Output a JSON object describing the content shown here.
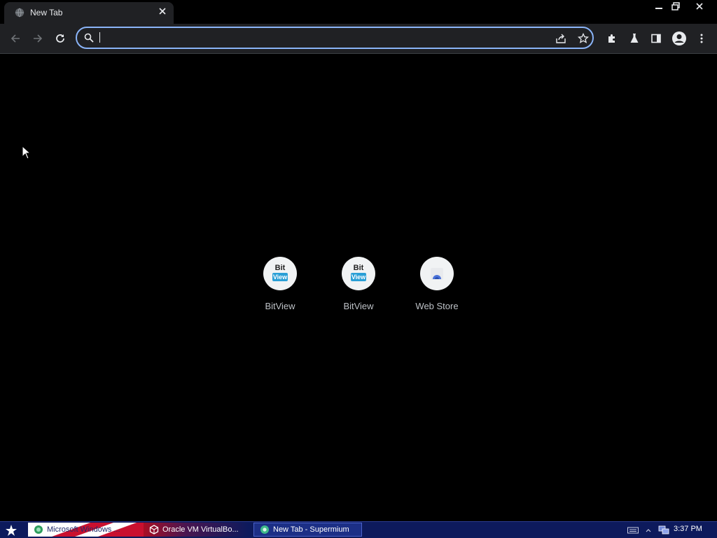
{
  "tab": {
    "title": "New Tab",
    "favicon": "globe-icon",
    "close_icon": "close-icon"
  },
  "window_controls": {
    "minimize": "minimize-icon",
    "restore": "restore-icon",
    "close": "close-icon"
  },
  "toolbar": {
    "back": "back-arrow-icon",
    "forward": "forward-arrow-icon",
    "reload": "reload-icon",
    "omnibox": {
      "value": "",
      "search_icon": "search-icon",
      "share_icon": "share-icon",
      "bookmark_icon": "star-icon"
    },
    "extensions": "puzzle-icon",
    "labs": "flask-icon",
    "side_panel": "side-panel-icon",
    "profile": "avatar-icon",
    "menu": "kebab-menu-icon"
  },
  "shortcuts": [
    {
      "label": "BitView",
      "logo_top": "Bit",
      "logo_bottom": "View"
    },
    {
      "label": "BitView",
      "logo_top": "Bit",
      "logo_bottom": "View"
    },
    {
      "label": "Web Store"
    }
  ],
  "taskbar": {
    "items": [
      {
        "label": "Microsoft Windows ..."
      },
      {
        "label": "Oracle VM VirtualBo..."
      },
      {
        "label": "New Tab - Supermium"
      }
    ],
    "clock": "3:37 PM"
  },
  "colors": {
    "accent": "#8ab4f8",
    "toolbar_bg": "#202124",
    "taskbar_bg": "#0d1a5c"
  }
}
